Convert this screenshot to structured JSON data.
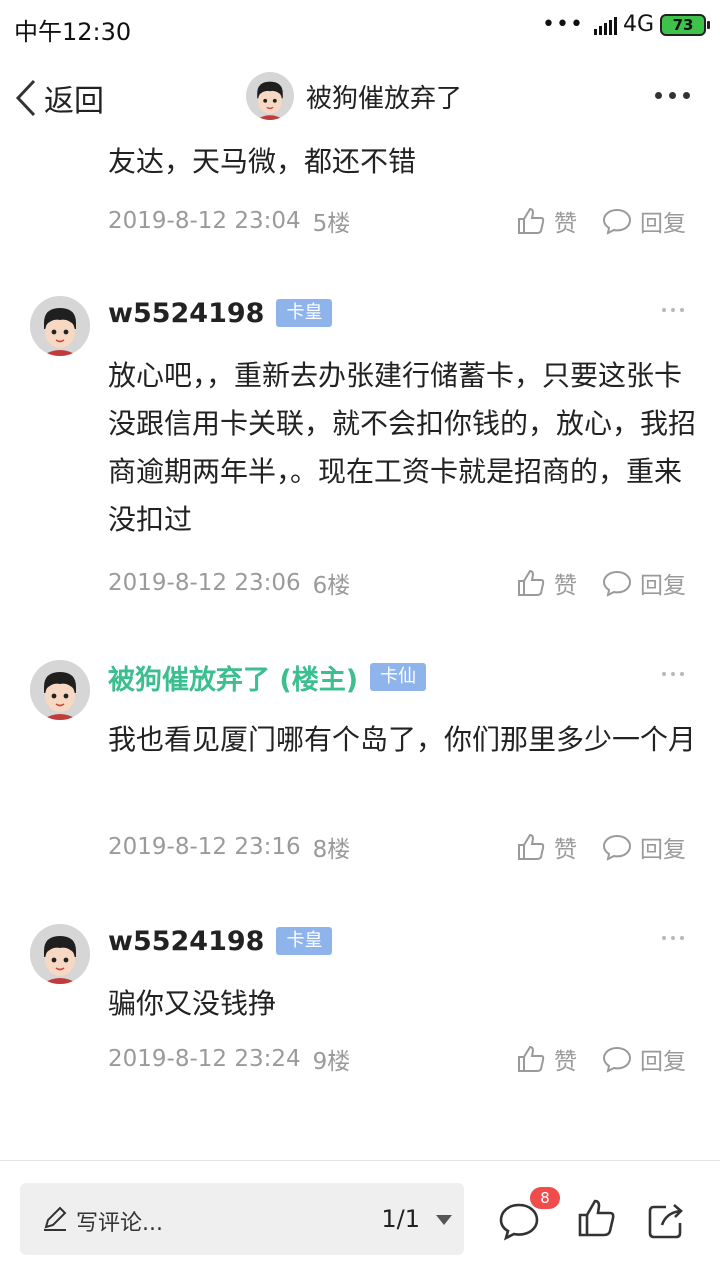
{
  "status_bar": {
    "time": "中午12:30",
    "network": "4G",
    "battery": "73"
  },
  "nav": {
    "back_label": "返回",
    "title": "被狗催放弃了"
  },
  "comments": [
    {
      "text": "友达，天马微，都还不错",
      "date": "2019-8-12 23:04",
      "floor": "5楼",
      "like_label": "赞",
      "reply_label": "回复"
    },
    {
      "user": "w5524198",
      "badge": "卡皇",
      "text": "放心吧，，重新去办张建行储蓄卡，只要这张卡没跟信用卡关联，就不会扣你钱的，放心，我招商逾期两年半，。现在工资卡就是招商的，重来没扣过",
      "date": "2019-8-12 23:06",
      "floor": "6楼",
      "like_label": "赞",
      "reply_label": "回复"
    },
    {
      "user": "被狗催放弃了 (楼主)",
      "badge": "卡仙",
      "text": "我也看见厦门哪有个岛了，你们那里多少一个月",
      "date": "2019-8-12 23:16",
      "floor": "8楼",
      "like_label": "赞",
      "reply_label": "回复"
    },
    {
      "user": "w5524198",
      "badge": "卡皇",
      "text": "骗你又没钱挣",
      "date": "2019-8-12 23:24",
      "floor": "9楼",
      "like_label": "赞",
      "reply_label": "回复"
    }
  ],
  "bottom": {
    "comment_placeholder": "写评论...",
    "page_indicator": "1/1",
    "comment_count": "8"
  },
  "colors": {
    "op_name": "#3bbf8f",
    "badge_bg": "#8fb4ec",
    "count_badge": "#f04c4c"
  }
}
